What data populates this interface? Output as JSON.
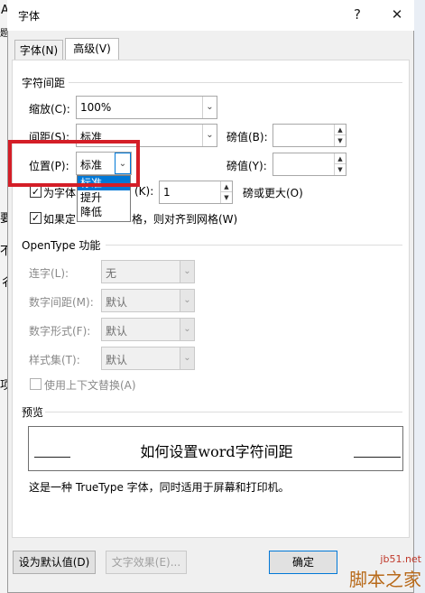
{
  "dialog": {
    "title": "字体",
    "help_label": "?",
    "close_label": "✕"
  },
  "background": {
    "chars": [
      "A",
      "题",
      "要",
      "不",
      "彳",
      "项"
    ]
  },
  "tabs": [
    {
      "label": "字体(N)",
      "active": false
    },
    {
      "label": "高级(V)",
      "active": true
    }
  ],
  "spacing": {
    "section_title": "字符间距",
    "scale_label": "缩放(C):",
    "scale_value": "100%",
    "spacing_label": "间距(S):",
    "spacing_value": "标准",
    "spacing_pt_label": "磅值(B):",
    "spacing_pt_value": "",
    "position_label": "位置(P):",
    "position_value": "标准",
    "position_pt_label": "磅值(Y):",
    "position_pt_value": "",
    "position_options": [
      "标准",
      "提升",
      "降低"
    ],
    "kerning_label_pre": "为字体",
    "kerning_label_mid": "(K):",
    "kerning_value": "1",
    "kerning_suffix": "磅或更大(O)",
    "grid_label_pre": "如果定",
    "grid_label_post": "格，则对齐到网格(W)"
  },
  "opentype": {
    "section_title": "OpenType 功能",
    "ligature_label": "连字(L):",
    "ligature_value": "无",
    "numspacing_label": "数字间距(M):",
    "numspacing_value": "默认",
    "numform_label": "数字形式(F):",
    "numform_value": "默认",
    "styleset_label": "样式集(T):",
    "styleset_value": "默认",
    "contextual_label": "使用上下文替换(A)"
  },
  "preview": {
    "section_title": "预览",
    "sample_text": "如何设置word字符间距",
    "description": "这是一种 TrueType 字体，同时适用于屏幕和打印机。"
  },
  "buttons": {
    "set_default": "设为默认值(D)",
    "text_effects": "文字效果(E)...",
    "ok": "确定"
  },
  "watermark": {
    "site": "jb51.net",
    "brand": "脚本之家"
  },
  "colors": {
    "highlight_red": "#d41e27",
    "selection_blue": "#0078d7"
  }
}
